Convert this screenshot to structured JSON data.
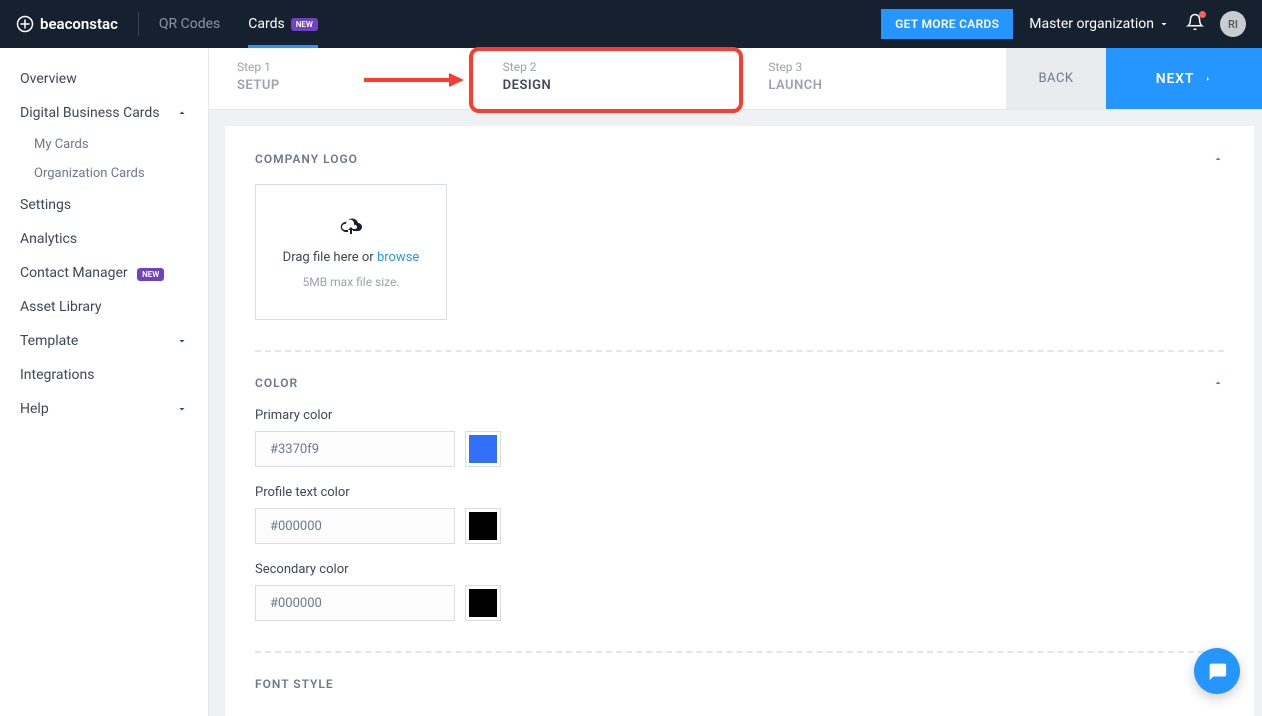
{
  "brand": "beaconstac",
  "topnav": {
    "qr": "QR Codes",
    "cards": "Cards",
    "new_badge": "NEW"
  },
  "header": {
    "getmore": "GET MORE CARDS",
    "org": "Master organization",
    "avatar": "RI"
  },
  "sidebar": {
    "overview": "Overview",
    "dbc": "Digital Business Cards",
    "mycards": "My Cards",
    "orgcards": "Organization Cards",
    "settings": "Settings",
    "analytics": "Analytics",
    "contact": "Contact Manager",
    "asset": "Asset Library",
    "template": "Template",
    "integrations": "Integrations",
    "help": "Help",
    "new_badge": "NEW"
  },
  "steps": {
    "s1num": "Step 1",
    "s1name": "SETUP",
    "s2num": "Step 2",
    "s2name": "DESIGN",
    "s3num": "Step 3",
    "s3name": "LAUNCH",
    "back": "BACK",
    "next": "NEXT"
  },
  "sections": {
    "company_logo": "COMPANY LOGO",
    "color": "COLOR",
    "font": "FONT STYLE"
  },
  "upload": {
    "text": "Drag file here or ",
    "browse": "browse",
    "hint": "5MB max file size."
  },
  "color": {
    "primary_label": "Primary color",
    "primary_value": "#3370f9",
    "profile_label": "Profile text color",
    "profile_value": "#000000",
    "secondary_label": "Secondary color",
    "secondary_value": "#000000"
  }
}
